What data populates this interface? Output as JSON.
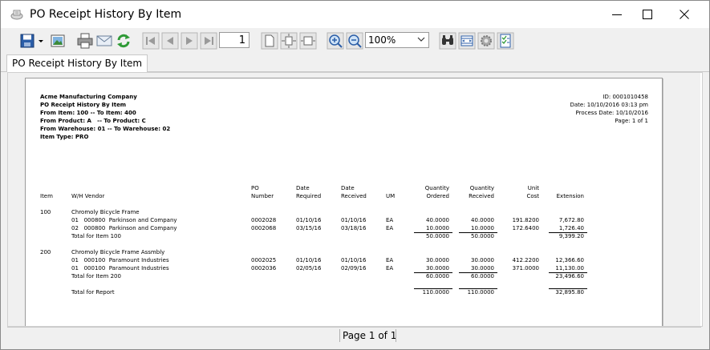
{
  "window": {
    "title": "PO Receipt History By Item"
  },
  "toolbar": {
    "page_value": "1",
    "zoom_value": "100%"
  },
  "tab": {
    "label": "PO Receipt History By Item"
  },
  "report": {
    "company": "Acme Manufacturing Company",
    "name": "PO Receipt History By Item",
    "filter_item": "From Item: 100 -- To Item: 400",
    "filter_product": "From Product: A   -- To Product: C",
    "filter_warehouse": "From Warehouse: 01 -- To Warehouse: 02",
    "filter_type": "Item Type: PRO",
    "id": "ID: 0001010458",
    "date": "Date: 10/10/2016 03:13 pm",
    "process_date": "Process Date: 10/10/2016",
    "page": "Page: 1 of 1",
    "headers": {
      "item": "Item",
      "wh_vendor": "W/H Vendor",
      "po_1": "PO",
      "po_2": "Number",
      "dreq_1": "Date",
      "dreq_2": "Required",
      "drec_1": "Date",
      "drec_2": "Received",
      "um": "UM",
      "qo_1": "Quantity",
      "qo_2": "Ordered",
      "qr_1": "Quantity",
      "qr_2": "Received",
      "uc_1": "Unit",
      "uc_2": "Cost",
      "ext": "Extension"
    },
    "groups": [
      {
        "item": "100",
        "desc": "Chromoly Bicycle Frame",
        "lines": [
          {
            "wh_vendor": "01   000800  Parkinson and Company",
            "po": "0002028",
            "dreq": "01/10/16",
            "drec": "01/10/16",
            "um": "EA",
            "qo": "40.0000",
            "qr": "40.0000",
            "uc": "191.8200",
            "ext": "7,672.80"
          },
          {
            "wh_vendor": "02   000800  Parkinson and Company",
            "po": "0002068",
            "dreq": "03/15/16",
            "drec": "03/18/16",
            "um": "EA",
            "qo": "10.0000",
            "qr": "10.0000",
            "uc": "172.6400",
            "ext": "1,726.40"
          }
        ],
        "total_label": "Total for Item 100",
        "total_qo": "50.0000",
        "total_qr": "50.0000",
        "total_ext": "9,399.20"
      },
      {
        "item": "200",
        "desc": "Chromoly Bicycle Frame Assmbly",
        "lines": [
          {
            "wh_vendor": "01   000100  Paramount Industries",
            "po": "0002025",
            "dreq": "01/10/16",
            "drec": "01/10/16",
            "um": "EA",
            "qo": "30.0000",
            "qr": "30.0000",
            "uc": "412.2200",
            "ext": "12,366.60"
          },
          {
            "wh_vendor": "01   000100  Paramount Industries",
            "po": "0002036",
            "dreq": "02/05/16",
            "drec": "02/09/16",
            "um": "EA",
            "qo": "30.0000",
            "qr": "30.0000",
            "uc": "371.0000",
            "ext": "11,130.00"
          }
        ],
        "total_label": "Total for Item 200",
        "total_qo": "60.0000",
        "total_qr": "60.0000",
        "total_ext": "23,496.60"
      }
    ],
    "grand": {
      "label": "Total for Report",
      "qo": "110.0000",
      "qr": "110.0000",
      "ext": "32,895.80"
    }
  },
  "status": {
    "page_text": "Page 1 of 1"
  },
  "icons": [
    "app-icon",
    "minimize-icon",
    "maximize-icon",
    "close-icon",
    "save-icon",
    "dropdown-arrow-icon",
    "export-image-icon",
    "print-icon",
    "email-icon",
    "refresh-icon",
    "first-page-icon",
    "previous-page-icon",
    "next-page-icon",
    "last-page-icon",
    "single-page-icon",
    "fit-page-icon",
    "fit-width-icon",
    "zoom-in-icon",
    "zoom-out-icon",
    "find-icon",
    "page-setup-icon",
    "settings-gear-icon",
    "parameters-icon"
  ]
}
